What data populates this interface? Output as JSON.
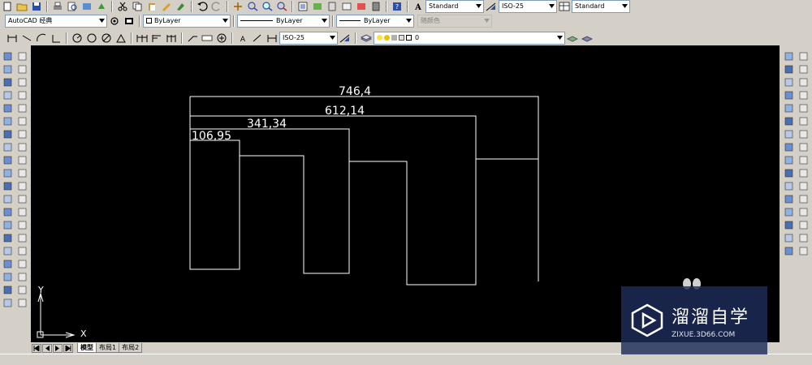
{
  "toolbar_top": {
    "text_style": "Standard",
    "dim_style": "ISO-25",
    "table_style": "Standard"
  },
  "toolbar_properties": {
    "workspace": "AutoCAD 经典",
    "layer_color": "ByLayer",
    "linetype": "ByLayer",
    "lineweight": "ByLayer",
    "plot_style": "随颜色"
  },
  "toolbar_dimension": {
    "dim_style": "ISO-25",
    "layer_name": "0"
  },
  "drawing": {
    "dimensions": [
      "746,4",
      "612,14",
      "341,34",
      "106,95"
    ],
    "ucs_x_label": "X",
    "ucs_y_label": "Y"
  },
  "layout_tabs": [
    "模型",
    "布局1",
    "布局2"
  ],
  "watermark": {
    "title": "溜溜自学",
    "url": "ZIXUE.3D66.COM"
  },
  "colors": {
    "canvas": "#000000",
    "chrome": "#d4d0c8",
    "drawing_line": "#ffffff",
    "watermark_bg": "#1e2c5c"
  },
  "icons": {
    "left_tools": [
      "point-icon",
      "line-icon",
      "construction-line-icon",
      "polyline-icon",
      "polygon-icon",
      "rectangle-icon",
      "arc-icon",
      "circle-icon",
      "revision-cloud-icon",
      "spline-icon",
      "ellipse-icon",
      "ellipse-arc-icon",
      "insert-block-icon",
      "make-block-icon",
      "point-marker-icon",
      "hatch-icon",
      "gradient-icon",
      "region-icon",
      "table-icon",
      "multiline-text-icon"
    ],
    "right_tools": [
      "erase-icon",
      "copy-icon",
      "mirror-icon",
      "offset-icon",
      "array-icon",
      "move-icon",
      "rotate-icon",
      "scale-icon",
      "stretch-icon",
      "trim-icon",
      "extend-icon",
      "break-icon",
      "join-icon",
      "chamfer-icon",
      "fillet-icon",
      "explode-icon"
    ]
  }
}
